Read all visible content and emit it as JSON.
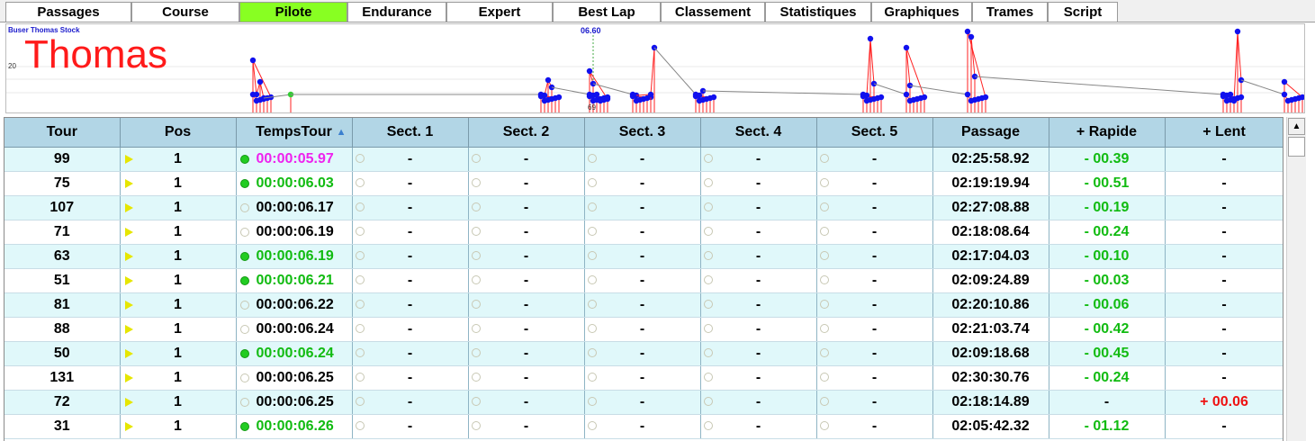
{
  "tabs": [
    {
      "label": "Passages",
      "active": false
    },
    {
      "label": "Course",
      "active": false
    },
    {
      "label": "Pilote",
      "active": true
    },
    {
      "label": "Endurance",
      "active": false
    },
    {
      "label": "Expert",
      "active": false
    },
    {
      "label": "Best Lap",
      "active": false
    },
    {
      "label": "Classement",
      "active": false
    },
    {
      "label": "Statistiques",
      "active": false
    },
    {
      "label": "Graphiques",
      "active": false
    },
    {
      "label": "Trames",
      "active": false
    },
    {
      "label": "Script",
      "active": false
    }
  ],
  "chart": {
    "driver_full": "Buser Thomas Stock",
    "driver_name": "Thomas",
    "y_tick": "20",
    "cursor_value": "06.60",
    "cursor_lap": "69"
  },
  "colors": {
    "accent_tab": "#88ff22",
    "header_bg": "#b2d6e6",
    "row_alt": "#e0f8fa",
    "best_green": "#11bb11",
    "fastest_magenta": "#ee22ee",
    "slower_red": "#ee1111"
  },
  "table": {
    "columns": [
      "Tour",
      "Pos",
      "TempsTour",
      "Sect. 1",
      "Sect. 2",
      "Sect. 3",
      "Sect. 4",
      "Sect. 5",
      "Passage",
      "+ Rapide",
      "+ Lent"
    ],
    "sort_icon": "sort-up-arrow-icon",
    "rows": [
      {
        "tour": "99",
        "pos": "1",
        "temps": "00:00:05.97",
        "best": true,
        "temps_color": "magenta",
        "s1": "-",
        "s2": "-",
        "s3": "-",
        "s4": "-",
        "s5": "-",
        "passage": "02:25:58.92",
        "rapide": "- 00.39",
        "lent": "-"
      },
      {
        "tour": "75",
        "pos": "1",
        "temps": "00:00:06.03",
        "best": true,
        "temps_color": "green",
        "s1": "-",
        "s2": "-",
        "s3": "-",
        "s4": "-",
        "s5": "-",
        "passage": "02:19:19.94",
        "rapide": "- 00.51",
        "lent": "-"
      },
      {
        "tour": "107",
        "pos": "1",
        "temps": "00:00:06.17",
        "best": false,
        "temps_color": "black",
        "s1": "-",
        "s2": "-",
        "s3": "-",
        "s4": "-",
        "s5": "-",
        "passage": "02:27:08.88",
        "rapide": "- 00.19",
        "lent": "-"
      },
      {
        "tour": "71",
        "pos": "1",
        "temps": "00:00:06.19",
        "best": false,
        "temps_color": "black",
        "s1": "-",
        "s2": "-",
        "s3": "-",
        "s4": "-",
        "s5": "-",
        "passage": "02:18:08.64",
        "rapide": "- 00.24",
        "lent": "-"
      },
      {
        "tour": "63",
        "pos": "1",
        "temps": "00:00:06.19",
        "best": true,
        "temps_color": "green",
        "s1": "-",
        "s2": "-",
        "s3": "-",
        "s4": "-",
        "s5": "-",
        "passage": "02:17:04.03",
        "rapide": "- 00.10",
        "lent": "-"
      },
      {
        "tour": "51",
        "pos": "1",
        "temps": "00:00:06.21",
        "best": true,
        "temps_color": "green",
        "s1": "-",
        "s2": "-",
        "s3": "-",
        "s4": "-",
        "s5": "-",
        "passage": "02:09:24.89",
        "rapide": "- 00.03",
        "lent": "-"
      },
      {
        "tour": "81",
        "pos": "1",
        "temps": "00:00:06.22",
        "best": false,
        "temps_color": "black",
        "s1": "-",
        "s2": "-",
        "s3": "-",
        "s4": "-",
        "s5": "-",
        "passage": "02:20:10.86",
        "rapide": "- 00.06",
        "lent": "-"
      },
      {
        "tour": "88",
        "pos": "1",
        "temps": "00:00:06.24",
        "best": false,
        "temps_color": "black",
        "s1": "-",
        "s2": "-",
        "s3": "-",
        "s4": "-",
        "s5": "-",
        "passage": "02:21:03.74",
        "rapide": "- 00.42",
        "lent": "-"
      },
      {
        "tour": "50",
        "pos": "1",
        "temps": "00:00:06.24",
        "best": true,
        "temps_color": "green",
        "s1": "-",
        "s2": "-",
        "s3": "-",
        "s4": "-",
        "s5": "-",
        "passage": "02:09:18.68",
        "rapide": "- 00.45",
        "lent": "-"
      },
      {
        "tour": "131",
        "pos": "1",
        "temps": "00:00:06.25",
        "best": false,
        "temps_color": "black",
        "s1": "-",
        "s2": "-",
        "s3": "-",
        "s4": "-",
        "s5": "-",
        "passage": "02:30:30.76",
        "rapide": "- 00.24",
        "lent": "-"
      },
      {
        "tour": "72",
        "pos": "1",
        "temps": "00:00:06.25",
        "best": false,
        "temps_color": "black",
        "s1": "-",
        "s2": "-",
        "s3": "-",
        "s4": "-",
        "s5": "-",
        "passage": "02:18:14.89",
        "rapide": "-",
        "lent": "+ 00.06"
      },
      {
        "tour": "31",
        "pos": "1",
        "temps": "00:00:06.26",
        "best": true,
        "temps_color": "green",
        "s1": "-",
        "s2": "-",
        "s3": "-",
        "s4": "-",
        "s5": "-",
        "passage": "02:05:42.32",
        "rapide": "- 01.12",
        "lent": "-"
      }
    ]
  }
}
